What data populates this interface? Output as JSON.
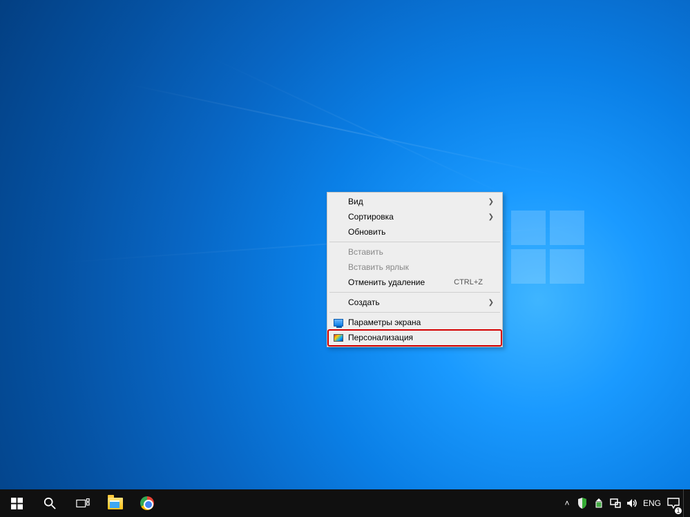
{
  "context_menu": {
    "items": [
      {
        "label": "Вид",
        "has_submenu": true
      },
      {
        "label": "Сортировка",
        "has_submenu": true
      },
      {
        "label": "Обновить"
      }
    ],
    "items2": [
      {
        "label": "Вставить",
        "disabled": true
      },
      {
        "label": "Вставить ярлык",
        "disabled": true
      },
      {
        "label": "Отменить удаление",
        "shortcut": "CTRL+Z"
      }
    ],
    "items3": [
      {
        "label": "Создать",
        "has_submenu": true
      }
    ],
    "items4": [
      {
        "label": "Параметры экрана",
        "icon": "display"
      },
      {
        "label": "Персонализация",
        "icon": "personalize",
        "highlighted": true
      }
    ]
  },
  "taskbar": {
    "start": "start-icon",
    "search": "search-icon",
    "taskview": "taskview-icon",
    "pinned": [
      {
        "name": "file-explorer"
      },
      {
        "name": "chrome"
      }
    ],
    "tray": {
      "chevron": "˄",
      "language": "ENG",
      "notifications_badge": "1"
    }
  }
}
